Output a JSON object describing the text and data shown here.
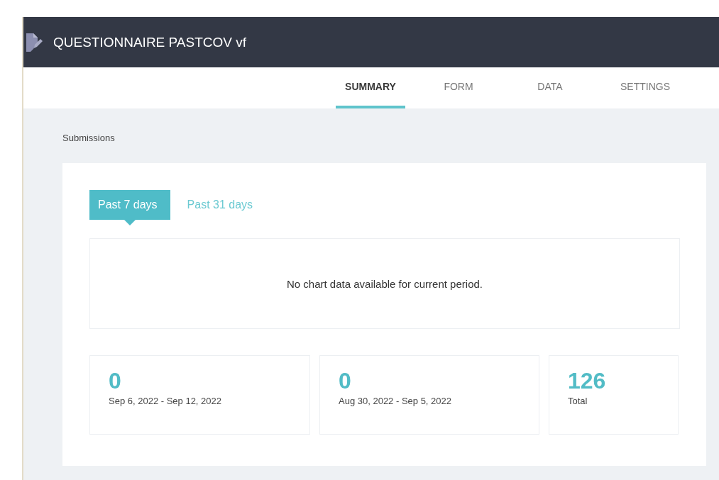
{
  "header": {
    "title": "QUESTIONNAIRE PASTCOV vf"
  },
  "nav_tabs": [
    {
      "label": "SUMMARY",
      "selected": true
    },
    {
      "label": "FORM",
      "selected": false
    },
    {
      "label": "DATA",
      "selected": false
    },
    {
      "label": "SETTINGS",
      "selected": false
    }
  ],
  "section_title": "Submissions",
  "period_tabs": [
    {
      "label": "Past 7 days",
      "selected": true
    },
    {
      "label": "Past 31 days",
      "selected": false
    }
  ],
  "chart_message": "No chart data available for current period.",
  "stats": [
    {
      "value": "0",
      "label": "Sep 6, 2022 - Sep 12, 2022"
    },
    {
      "value": "0",
      "label": "Aug 30, 2022 - Sep 5, 2022"
    },
    {
      "value": "126",
      "label": "Total"
    }
  ]
}
